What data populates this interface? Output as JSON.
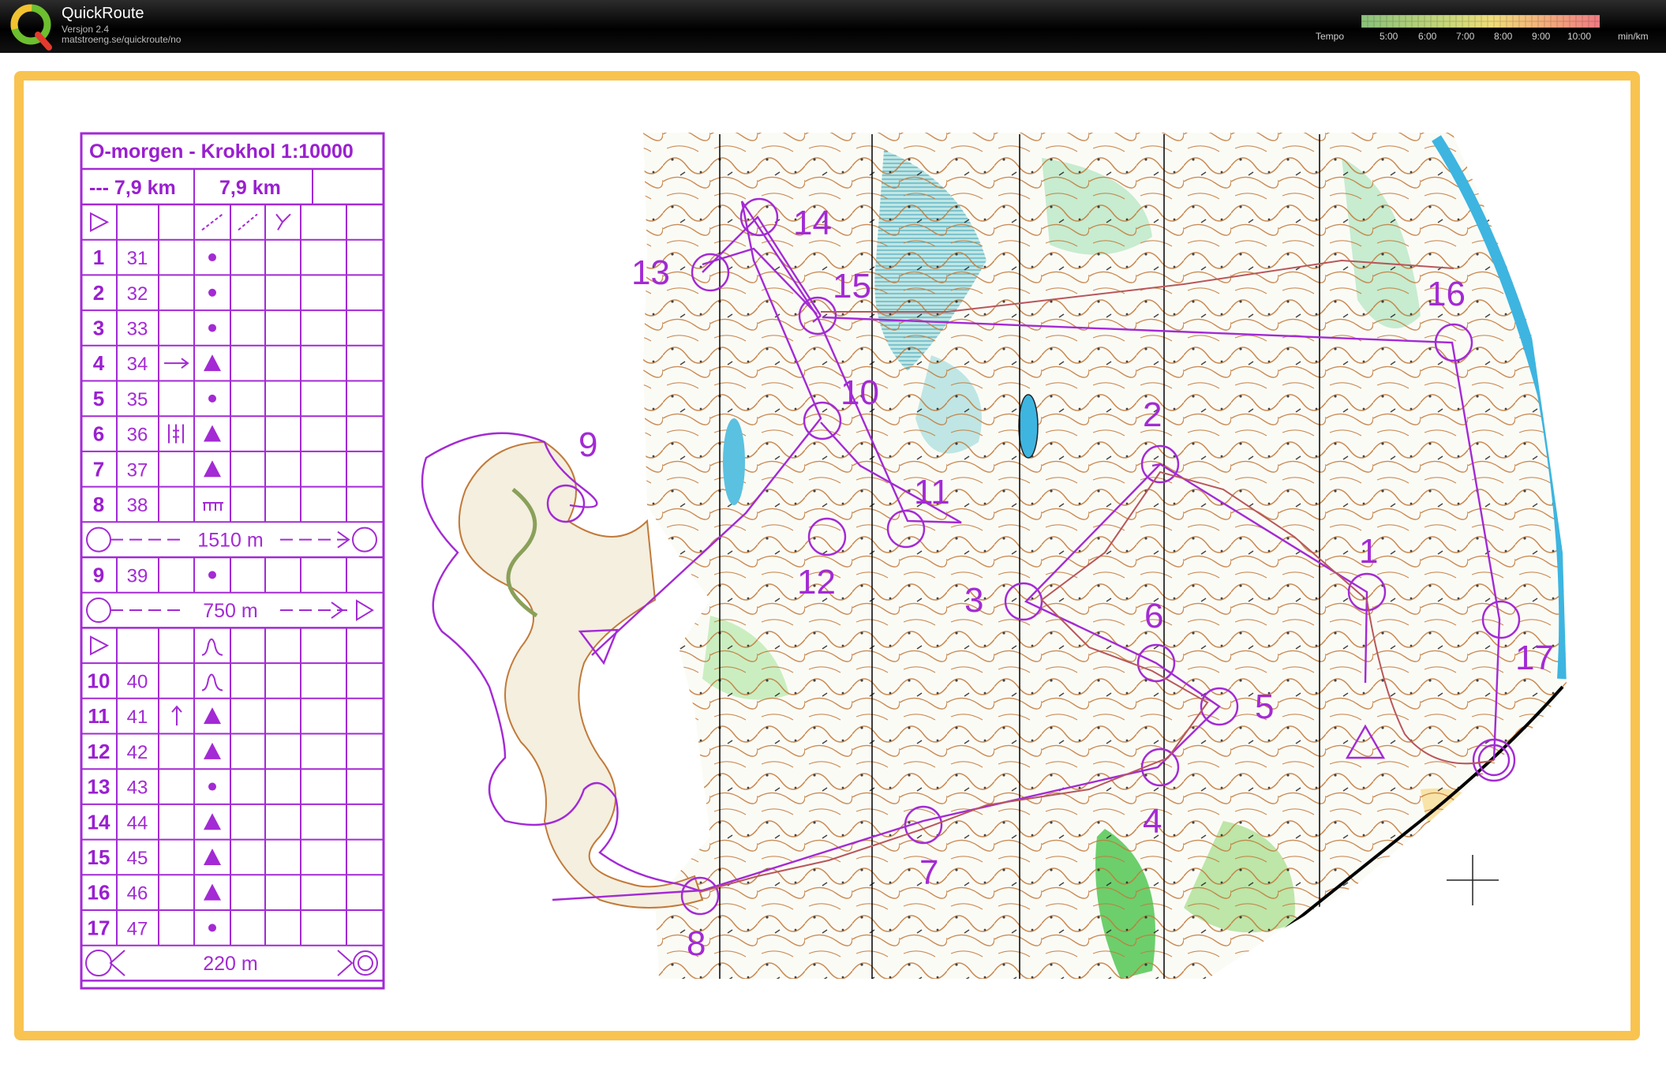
{
  "app": {
    "title": "QuickRoute",
    "version": "Versjon 2.4",
    "url": "matstroeng.se/quickroute/no"
  },
  "tempo": {
    "label": "Tempo",
    "ticks": [
      "5:00",
      "6:00",
      "7:00",
      "8:00",
      "9:00",
      "10:00"
    ],
    "unit": "min/km"
  },
  "colors": {
    "frame": "#f9c350",
    "course": "#a32ad4",
    "route": "#c0392b"
  },
  "control_card": {
    "title": "O-morgen - Krokhol 1:10000",
    "distance_left": "--- 7,9 km",
    "distance_right": "7,9 km",
    "controls": [
      {
        "num": "1",
        "code": "31"
      },
      {
        "num": "2",
        "code": "32"
      },
      {
        "num": "3",
        "code": "33"
      },
      {
        "num": "4",
        "code": "34"
      },
      {
        "num": "5",
        "code": "35"
      },
      {
        "num": "6",
        "code": "36"
      },
      {
        "num": "7",
        "code": "37"
      },
      {
        "num": "8",
        "code": "38"
      },
      {
        "num": "9",
        "code": "39"
      },
      {
        "num": "10",
        "code": "40"
      },
      {
        "num": "11",
        "code": "41"
      },
      {
        "num": "12",
        "code": "42"
      },
      {
        "num": "13",
        "code": "43"
      },
      {
        "num": "14",
        "code": "44"
      },
      {
        "num": "15",
        "code": "45"
      },
      {
        "num": "16",
        "code": "46"
      },
      {
        "num": "17",
        "code": "47"
      }
    ],
    "leg_1": "1510 m",
    "leg_2": "750 m",
    "finish_leg": "220 m"
  },
  "map_labels": [
    "1",
    "2",
    "3",
    "4",
    "5",
    "6",
    "7",
    "8",
    "9",
    "10",
    "11",
    "12",
    "13",
    "14",
    "15",
    "16",
    "17"
  ]
}
